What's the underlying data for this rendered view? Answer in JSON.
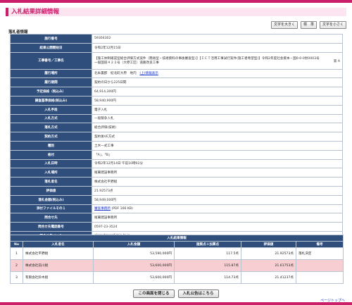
{
  "header": {
    "title": "入札結果詳細情報"
  },
  "font_controls": [
    "文字を大きく",
    "標　準",
    "文字を小さく"
  ],
  "section": {
    "label": "落札者情報"
  },
  "info": {
    "r0": {
      "k": "施行番号",
      "v": "59304302"
    },
    "r1": {
      "k": "結果公開開始日",
      "v": "令和2年12月15日"
    },
    "r2": {
      "k": "工事番号／工事名",
      "v": "【施工体制確認型総合評価方式案件（簡易型・技術資料の事後審査型）】【ＩＣＴ活用工事試行案件(施工者希望型)】令和2年度社会資本・国0-0-0労0003号一般国道４２２号（大原工区）道路改良工事",
      "mark": "第 A"
    },
    "r3": {
      "k": "履行場所",
      "v": "北牟婁郡　紀北町大原　地内",
      "link": "(上)情報表示"
    },
    "r4": {
      "k": "履行期間",
      "v": "契約の日から225日間"
    },
    "r5": {
      "k": "予定価格（税込み）",
      "v": "64,914,300円"
    },
    "r6": {
      "k": "調査基準価格(税込み)",
      "v": "58,940,900円"
    },
    "r7": {
      "k": "入札手段",
      "v": "電子入札"
    },
    "r8": {
      "k": "入札方式",
      "v": "一般競争入札"
    },
    "r9": {
      "k": "落札方式",
      "v": "総合評価(技術)"
    },
    "r10": {
      "k": "契約方式",
      "v": "契約後VE方式"
    },
    "r11": {
      "k": "種別",
      "v": "土木一式工事"
    },
    "r12": {
      "k": "格付",
      "v": "「A」、「B」"
    },
    "r13": {
      "k": "入札日時",
      "v": "令和2年12月14日 午前10時02分"
    },
    "r14": {
      "k": "入札場所",
      "v": "尾鷲建設事務所"
    },
    "r15": {
      "k": "落札者名",
      "v": "株式会社平野組"
    },
    "r16": {
      "k": "評価値",
      "v": "21.92573点"
    },
    "r17": {
      "k": "落札金額(税込み)",
      "v": "58,949,000円"
    },
    "r18": {
      "k": "添付ファイルその１",
      "link": "審査事務所",
      "v": "(PDF 166 KB)"
    },
    "r19": {
      "k": "問合せ先",
      "v": "尾鷲建設事務所"
    },
    "r20": {
      "k": "問合せ先電話番号",
      "v": "0597-23-3524"
    },
    "r21": {
      "k": "問合せ先メール",
      "v": "okenet@pref.mie.lg.jp"
    }
  },
  "results": {
    "caption": "入札結果情報",
    "headers": [
      "No",
      "入札者名",
      "入札金額",
      "施策点＋加算点",
      "評価値",
      "備考"
    ],
    "rows": [
      {
        "no": "1",
        "name": "株式会社平野組",
        "amount": "53,590,000円",
        "score": "117.5点",
        "eval": "21.92573点",
        "note": "落札決定"
      },
      {
        "no": "2",
        "name": "株式会社前川組",
        "amount": "53,600,000円",
        "score": "115.87点",
        "eval": "21.61753点",
        "note": ""
      },
      {
        "no": "3",
        "name": "有限会社鈴木組",
        "amount": "53,600,000円",
        "score": "114.73点",
        "eval": "21.41237点",
        "note": ""
      }
    ]
  },
  "buttons": {
    "close": "この画面を閉じる",
    "notice": "入札公告はこちら"
  },
  "pagetop": "ページトップへ",
  "colors": {
    "accent": "#cc1f6a",
    "header_bg": "#2f4e7c",
    "highlight_row": "#f7cfd2"
  }
}
